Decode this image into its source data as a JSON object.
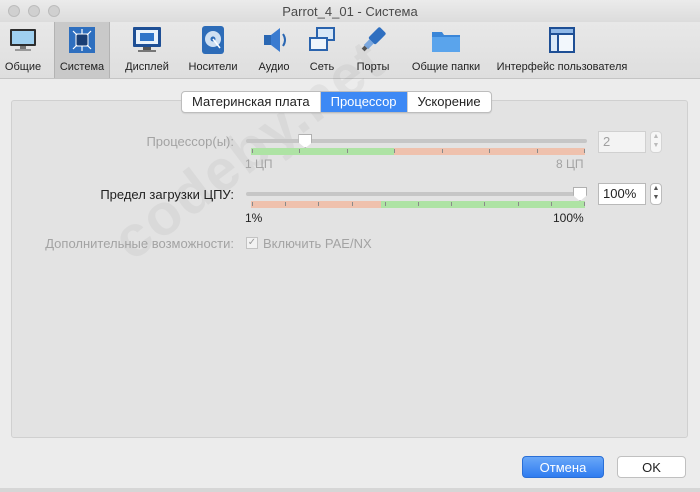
{
  "window": {
    "title": "Parrot_4_01 - Система"
  },
  "toolbar": {
    "items": [
      {
        "label": "Общие",
        "icon": "general-monitor-icon"
      },
      {
        "label": "Система",
        "icon": "system-chip-icon"
      },
      {
        "label": "Дисплей",
        "icon": "display-icon"
      },
      {
        "label": "Носители",
        "icon": "storage-disk-icon"
      },
      {
        "label": "Аудио",
        "icon": "audio-speaker-icon"
      },
      {
        "label": "Сеть",
        "icon": "network-icon"
      },
      {
        "label": "Порты",
        "icon": "ports-plug-icon"
      },
      {
        "label": "Общие папки",
        "icon": "shared-folder-icon"
      },
      {
        "label": "Интерфейс пользователя",
        "icon": "user-interface-icon"
      }
    ],
    "active_index": 1
  },
  "tabs": {
    "items": [
      "Материнская плата",
      "Процессор",
      "Ускорение"
    ],
    "selected_index": 1
  },
  "processor": {
    "label": "Процессор(ы):",
    "min_label": "1 ЦП",
    "max_label": "8 ЦП",
    "value": "2",
    "slider_fraction": 0.16,
    "enabled": false
  },
  "cpu_limit": {
    "label": "Предел загрузки ЦПУ:",
    "min_label": "1%",
    "max_label": "100%",
    "value": "100%",
    "slider_fraction": 1.0,
    "enabled": true
  },
  "extended": {
    "label": "Дополнительные возможности:",
    "checkbox_label": "Включить PAE/NX",
    "checked": true,
    "enabled": false
  },
  "watermark": {
    "text": "codeby.net"
  },
  "buttons": {
    "cancel": "Отмена",
    "ok": "OK"
  },
  "colors": {
    "accent": "#3d89f5",
    "zone_ok": "#aee3a4",
    "zone_warn": "#efc1ad"
  }
}
